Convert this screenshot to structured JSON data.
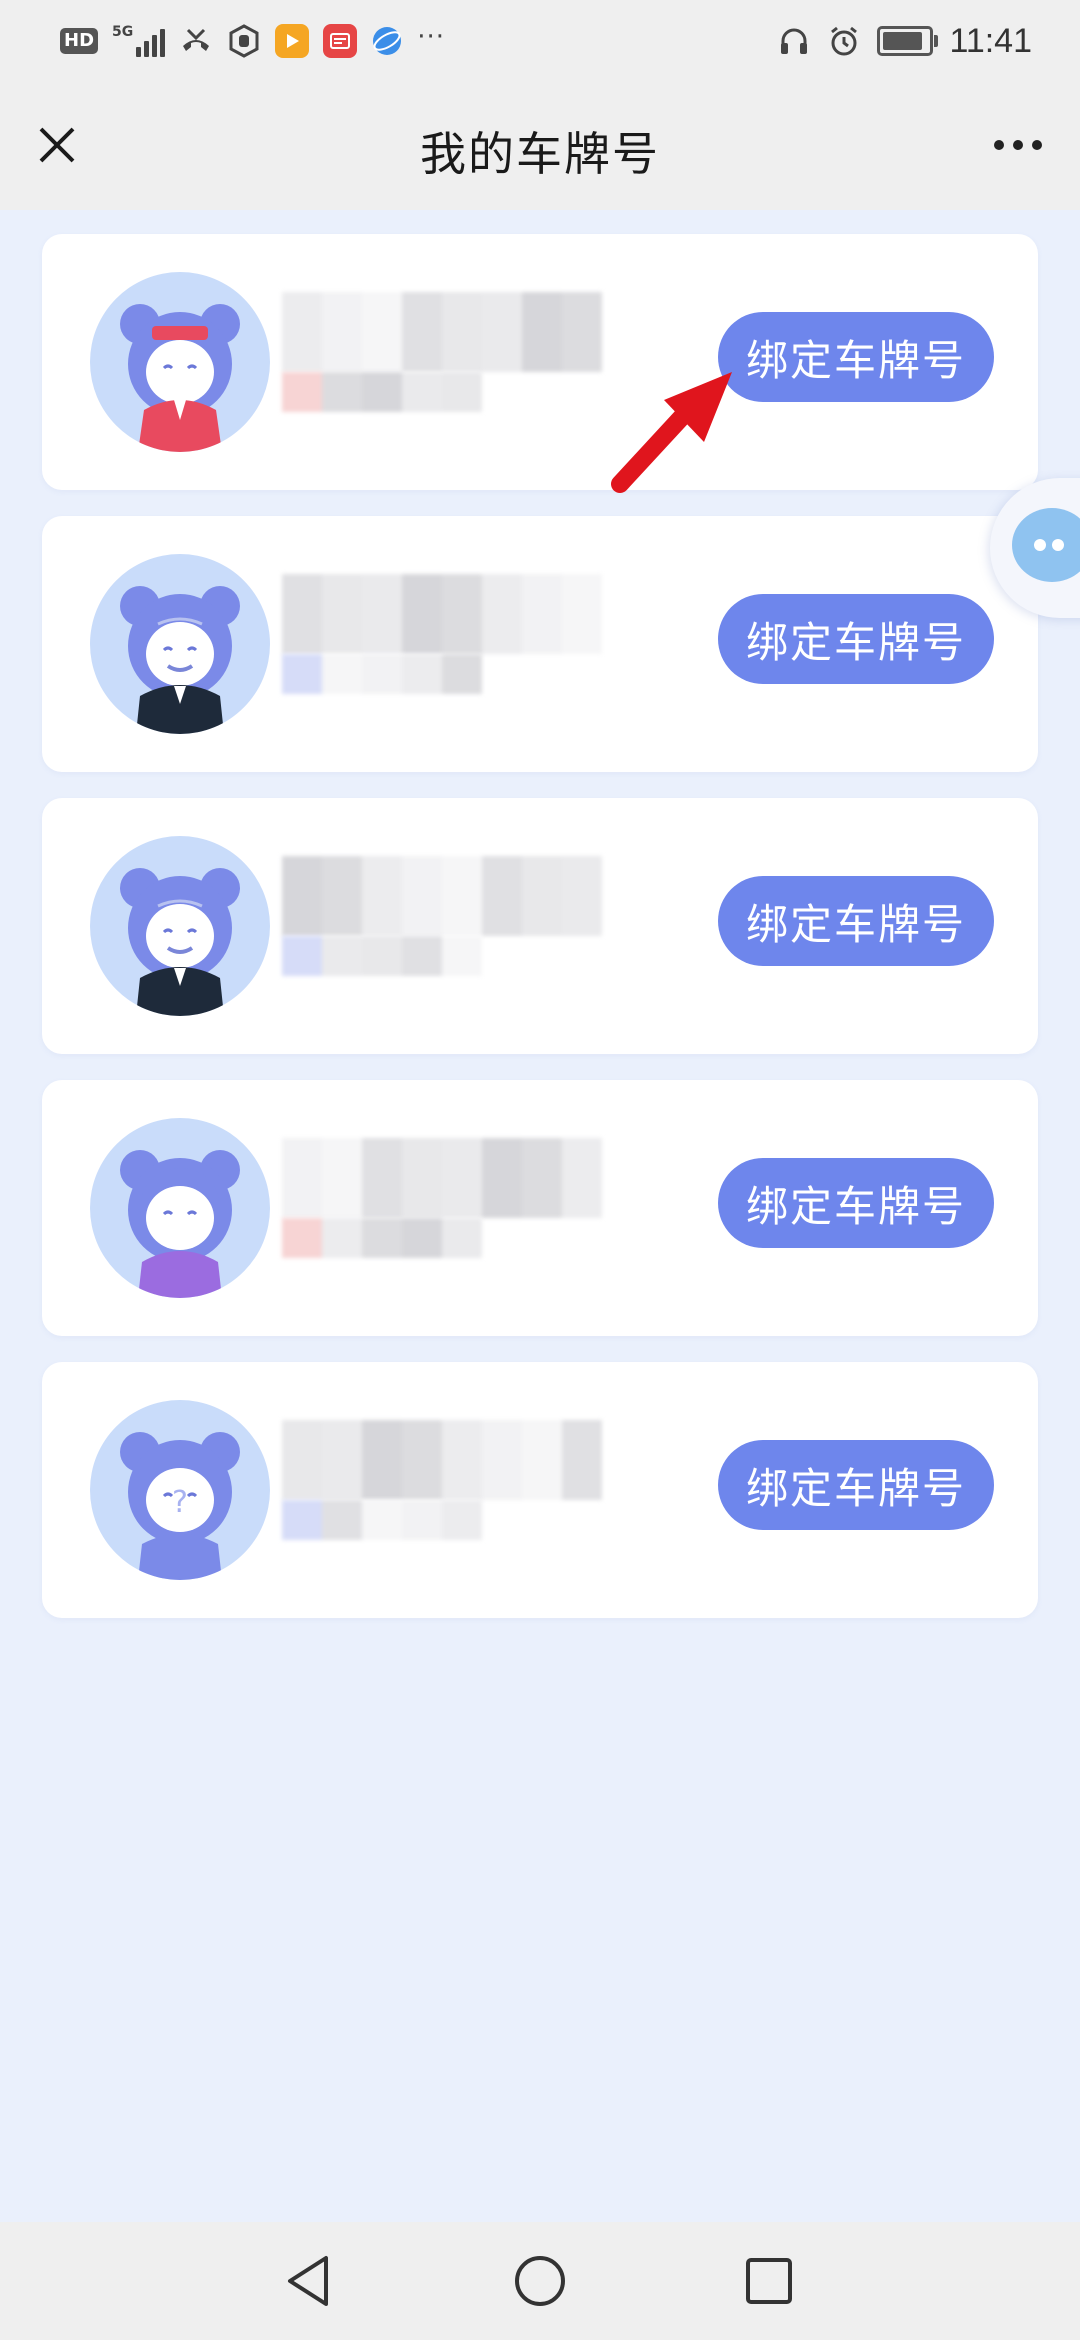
{
  "status_bar": {
    "network_badge": "HD",
    "network_type": "5G",
    "time": "11:41",
    "more": "···"
  },
  "header": {
    "title": "我的车牌号"
  },
  "vehicles": [
    {
      "bind_label": "绑定车牌号",
      "avatar": "avatar-woman-red-icon",
      "accent": "#f7d4d4"
    },
    {
      "bind_label": "绑定车牌号",
      "avatar": "avatar-elder-man-icon",
      "accent": "#d6dcf8"
    },
    {
      "bind_label": "绑定车牌号",
      "avatar": "avatar-elder-man-icon",
      "accent": "#d6dcf8"
    },
    {
      "bind_label": "绑定车牌号",
      "avatar": "avatar-elder-woman-icon",
      "accent": "#f7d4d4"
    },
    {
      "bind_label": "绑定车牌号",
      "avatar": "avatar-unknown-icon",
      "accent": "#d6dcf8"
    }
  ],
  "colors": {
    "accent": "#6e86ec",
    "background": "#eaf0fc",
    "annotation_arrow": "#e0151d"
  }
}
